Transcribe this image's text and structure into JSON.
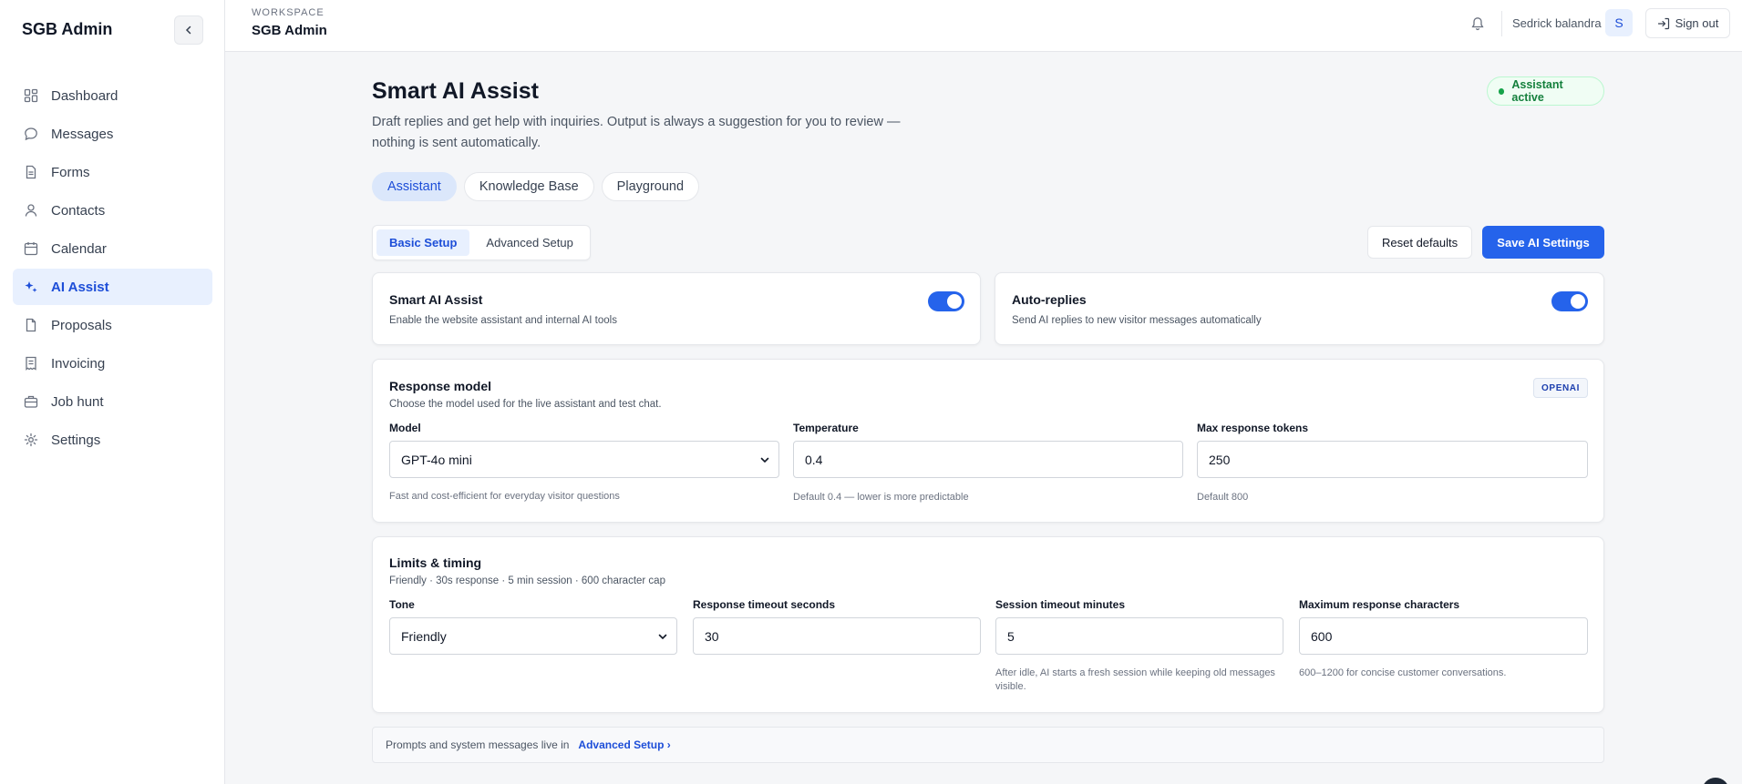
{
  "sidebar": {
    "brand": "SGB Admin",
    "items": [
      {
        "label": "Dashboard",
        "icon": "grid-icon"
      },
      {
        "label": "Messages",
        "icon": "chat-icon"
      },
      {
        "label": "Forms",
        "icon": "document-icon"
      },
      {
        "label": "Contacts",
        "icon": "user-icon"
      },
      {
        "label": "Calendar",
        "icon": "calendar-icon"
      },
      {
        "label": "AI Assist",
        "icon": "sparkle-icon",
        "active": true
      },
      {
        "label": "Proposals",
        "icon": "file-icon"
      },
      {
        "label": "Invoicing",
        "icon": "receipt-icon"
      },
      {
        "label": "Job hunt",
        "icon": "briefcase-icon"
      },
      {
        "label": "Settings",
        "icon": "gear-icon"
      }
    ]
  },
  "header": {
    "workspace_label": "WORKSPACE",
    "workspace_name": "SGB Admin",
    "user_name": "Sedrick balandra",
    "avatar_initial": "S",
    "signout_label": "Sign out"
  },
  "page": {
    "title": "Smart AI Assist",
    "description": "Draft replies and get help with inquiries. Output is always a suggestion for you to review — nothing is sent automatically.",
    "status": "Assistant active",
    "tabs": [
      "Assistant",
      "Knowledge Base",
      "Playground"
    ],
    "segments": [
      "Basic Setup",
      "Advanced Setup"
    ],
    "reset_label": "Reset defaults",
    "save_label": "Save AI Settings"
  },
  "toggles": {
    "smart": {
      "title": "Smart AI Assist",
      "desc": "Enable the website assistant and internal AI tools",
      "on": true
    },
    "auto": {
      "title": "Auto-replies",
      "desc": "Send AI replies to new visitor messages automatically",
      "on": true
    }
  },
  "response_model": {
    "title": "Response model",
    "desc": "Choose the model used for the live assistant and test chat.",
    "provider": "OPENAI",
    "model_label": "Model",
    "model_value": "GPT-4o mini",
    "model_hint": "Fast and cost-efficient for everyday visitor questions",
    "temp_label": "Temperature",
    "temp_value": "0.4",
    "temp_hint": "Default 0.4 — lower is more predictable",
    "tokens_label": "Max response tokens",
    "tokens_value": "250",
    "tokens_hint": "Default 800"
  },
  "limits": {
    "title": "Limits & timing",
    "desc": "Friendly · 30s response · 5 min session · 600 character cap",
    "tone_label": "Tone",
    "tone_value": "Friendly",
    "resp_label": "Response timeout seconds",
    "resp_value": "30",
    "session_label": "Session timeout minutes",
    "session_value": "5",
    "session_hint": "After idle, AI starts a fresh session while keeping old messages visible.",
    "chars_label": "Maximum response characters",
    "chars_value": "600",
    "chars_hint": "600–1200 for concise customer conversations."
  },
  "footer": {
    "text": "Prompts and system messages live in",
    "link": "Advanced Setup ›"
  },
  "colors": {
    "accent": "#2563eb",
    "active_bg": "#e8f0fe",
    "success": "#15803d"
  }
}
